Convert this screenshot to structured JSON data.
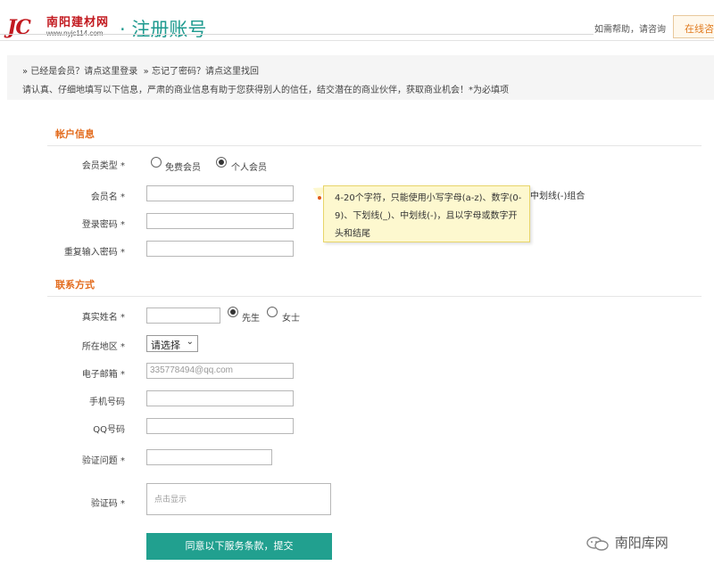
{
  "header": {
    "logo_mark": "JC",
    "logo_name": "南阳建材网",
    "logo_url": "www.nyjc114.com",
    "title": "· 注册账号",
    "help_text": "如需帮助，请咨询",
    "online_button": "在线咨"
  },
  "notice": {
    "login_link": "» 已经是会员？请点这里登录",
    "forgot_link": "» 忘记了密码？请点这里找回",
    "description": "请认真、仔细地填写以下信息，严肃的商业信息有助于您获得别人的信任，结交潜在的商业伙伴，获取商业机会！*为必填项"
  },
  "account_section": {
    "title": "帐户信息",
    "member_type_label": "会员类型 *",
    "member_type_options": [
      "免费会员",
      "个人会员"
    ],
    "member_type_selected": "个人会员",
    "username_label": "会员名 *",
    "username_value": "",
    "password_label": "登录密码 *",
    "password_repeat_label": "重复输入密码 *",
    "tooltip": "4-20个字符，只能使用小写字母(a-z)、数字(0-9)、下划线(_)、中划线(-)，且以字母或数字开头和结尾",
    "tooltip_behind": "中划线(-)组合"
  },
  "contact_section": {
    "title": "联系方式",
    "real_name_label": "真实姓名 *",
    "gender_options": [
      "先生",
      "女士"
    ],
    "gender_selected": "先生",
    "region_label": "所在地区 *",
    "region_select": "请选择",
    "email_label": "电子邮箱 *",
    "email_value": "335778494@qq.com",
    "phone_label": "手机号码",
    "qq_label": "QQ号码",
    "question_label": "验证问题 *",
    "captcha_label": "验证码 *",
    "captcha_placeholder": "点击显示"
  },
  "submit_label": "同意以下服务条款，提交",
  "watermark": "南阳库网",
  "colors": {
    "accent": "#21a08f",
    "section_title": "#e36c1e",
    "brand_red": "#c2191f"
  }
}
